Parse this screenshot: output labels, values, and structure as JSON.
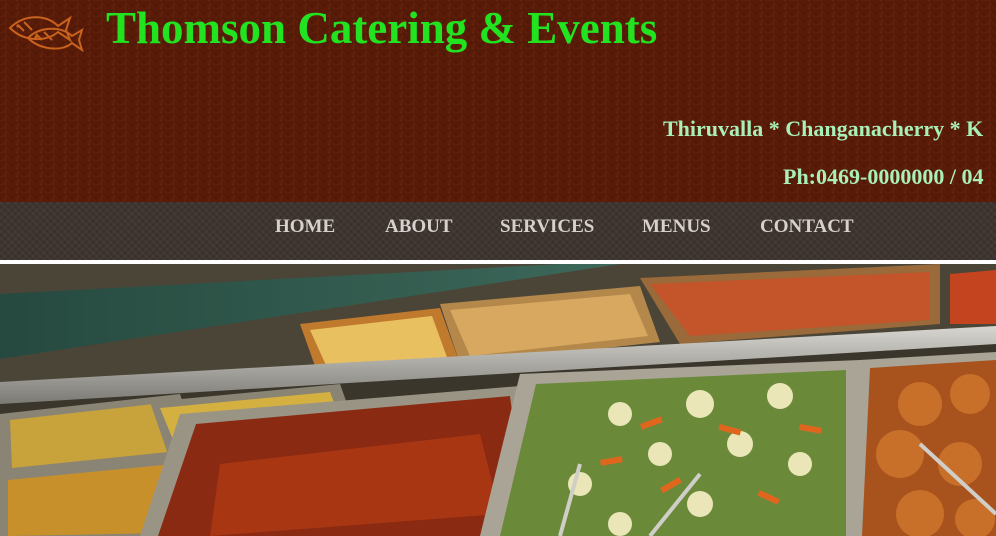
{
  "header": {
    "logo_icon": "fish-logo-icon",
    "title": "Thomson Catering & Events",
    "locations": "Thiruvalla * Changanacherry * K",
    "phone": "Ph:0469-0000000 / 04"
  },
  "nav": {
    "items": [
      {
        "label": "HOME"
      },
      {
        "label": "ABOUT"
      },
      {
        "label": "SERVICES"
      },
      {
        "label": "MENUS"
      },
      {
        "label": "CONTACT"
      }
    ]
  },
  "hero": {
    "image": "buffet-food-trays-image"
  },
  "colors": {
    "header_bg": "#5a1c08",
    "title": "#22e31f",
    "info_text": "#a8f0b8",
    "nav_bg": "#3e3430",
    "nav_text": "#d6d1cc"
  }
}
